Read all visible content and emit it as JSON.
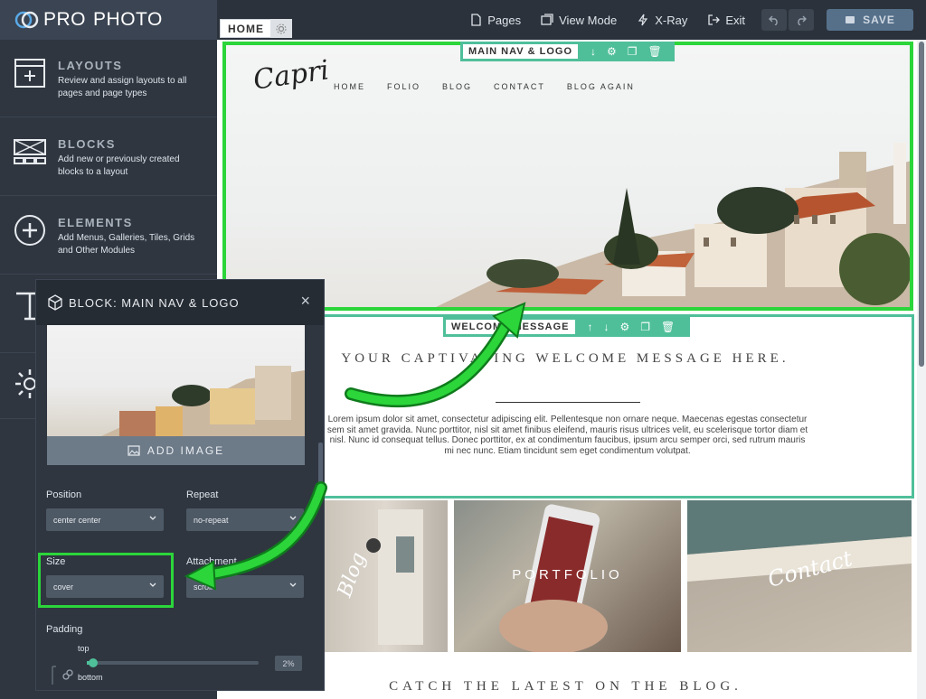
{
  "app": {
    "brand_left": "PRO",
    "brand_right": "PHOTO"
  },
  "topnav": {
    "pages": "Pages",
    "view_mode": "View Mode",
    "xray": "X-Ray",
    "exit": "Exit",
    "save": "SAVE"
  },
  "sidebar": {
    "items": [
      {
        "title": "LAYOUTS",
        "desc": "Review and assign layouts to all pages and page types",
        "icon": "layout-icon"
      },
      {
        "title": "BLOCKS",
        "desc": "Add new or previously created blocks to a layout",
        "icon": "blocks-icon"
      },
      {
        "title": "ELEMENTS",
        "desc": "Add Menus, Galleries, Tiles, Grids and Other Modules",
        "icon": "plus-circle-icon"
      }
    ]
  },
  "canvas": {
    "home_tab": "HOME",
    "nav_tag": "MAIN NAV & LOGO",
    "welcome_tag": "WELCOME MESSAGE",
    "brand": "Capri",
    "site_nav": [
      "HOME",
      "FOLIO",
      "BLOG",
      "CONTACT",
      "BLOG AGAIN"
    ],
    "welcome_title": "YOUR CAPTIVATING WELCOME MESSAGE HERE.",
    "welcome_body": "Lorem ipsum dolor sit amet, consectetur adipiscing elit. Pellentesque non ornare neque. Maecenas egestas consectetur sem sit amet gravida. Nunc porttitor, nisl sit amet finibus eleifend, mauris risus ultrices velit, eu scelerisque tortor diam et nisl. Nunc id consequat tellus. Donec porttitor, ex at condimentum faucibus, ipsum arcu semper orci, sed rutrum mauris mi nec nunc. Etiam tincidunt sem eget condimentum volutpat.",
    "tiles": [
      "Blog",
      "PORTFOLIO",
      "Contact"
    ],
    "blog_banner": "CATCH THE LATEST ON THE BLOG."
  },
  "panel": {
    "title": "BLOCK: MAIN NAV & LOGO",
    "add_image": "ADD IMAGE",
    "position_label": "Position",
    "position_value": "center center",
    "repeat_label": "Repeat",
    "repeat_value": "no-repeat",
    "size_label": "Size",
    "size_value": "cover",
    "attachment_label": "Attachment",
    "attachment_value": "scroll",
    "padding_label": "Padding",
    "padding_top_label": "top",
    "padding_bottom_label": "bottom",
    "padding_top_value": "2%",
    "padding_top_fraction": 0.02
  },
  "colors": {
    "accent": "#4fbf9a",
    "highlight": "#2bd53a",
    "sidebar": "#2f3640",
    "topbar": "#2b323b"
  }
}
